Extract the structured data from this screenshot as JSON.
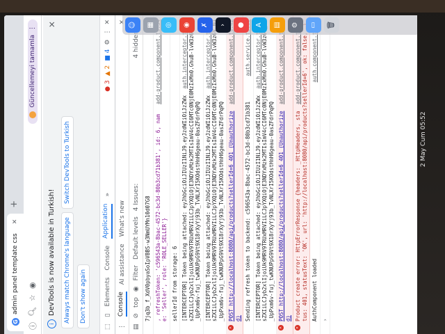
{
  "menubar": {
    "clock": "2 May Cum 05:52"
  },
  "browser": {
    "tab_title": "admin panel template css",
    "new_tab": "+",
    "update_button": "Güncellemeyi tamamla"
  },
  "infobar": {
    "message": "DevTools is now available in Turkish!",
    "btn_always_match": "Always match Chrome's language",
    "btn_switch": "Switch DevTools to Turkish",
    "btn_dont_show": "Don't show again"
  },
  "devtools": {
    "tabs": [
      "Elements",
      "Console",
      "Application"
    ],
    "more": "»",
    "errors": "3",
    "warnings": "2",
    "infos": "4",
    "drawer_tabs": [
      "Console",
      "AI assistance",
      "What's new"
    ],
    "context": "top",
    "filter_placeholder": "Filter",
    "levels": "Default levels",
    "issues": "4 Issues:",
    "issues_count": "4",
    "hidden": "4 hidden"
  },
  "console": {
    "entries": [
      {
        "kind": "log",
        "text": "7jq3b_f_XdV0pbyaSoIpVBBS-w3NmUYMn10d07G8",
        "src": ""
      },
      {
        "kind": "log",
        "text": ", refreshToken: 'c596543a-8bac-4572-bc3d-80b3cd71b381', id: 6, name: 'Seller', role: 'ROLE_SELLER'}",
        "src": "add-product.component.ts:34"
      },
      {
        "kind": "log",
        "text": "sellerId from storage: 6",
        "src": ""
      },
      {
        "kind": "log",
        "text": "[INTERCEPTOR] Token being attached: eyJhbGciOiJIUzI1NiJ9.eyJzdWIiOiJzZWxsZXIiLCJyb2xlIjoiUk9MRV9TRUxMRVIiLCJpYXQiOjE3NDYxMzk2MTIsImV4cCI6MTc0NjE0MzIxMn0.GhuB-lvW3z6V_Nu_UpPxm6v-fuj_twKNUPpG9Vt9X18rXyYj93b_TvNLXrI5KOdstHnH6geau-0asZFdrPqPQ",
        "src": "auth.interceptor.ts:19"
      },
      {
        "kind": "log",
        "text": "[INTERCEPTOR] Token being attached: eyJhbGciOiJIUzI1NiJ9.eyJzdWIiOiJzZWxsZXIiLCJyb2xlIjoiUk9MRV9TRUxMRVIiLCJpYXQiOjE3NDYxMzk2MTIsImV4cCI6MTc0NjE0MzIxMn0.GhuB-lvW3z6V_Nu_UpPxm6v-fuj_twKNUPpG9Vt9X18rXyYj93b_TvNLXrI5KOdstHnH6geau-0asZFdrPqPQ",
        "src": "auth.interceptor.ts:19"
      },
      {
        "kind": "err",
        "text": "POST http://localhost:8080/api/products?sellerId=6 401 (Unauthorized)",
        "src": "add-product.component.ts:42"
      },
      {
        "kind": "log",
        "text": "Sending refresh token to backend: c596543a-8bac-4572-bc3d-80b3cd71b381",
        "src": "auth.service.ts:69"
      },
      {
        "kind": "log",
        "text": "[INTERCEPTOR] Token being attached: eyJhbGciOiJIUzI1NiJ9.eyJzdWIiOiJzZWxsZXIiLCJyb2xlIjoiUk9MRV9TRUxMRVIiLCJpYXQiOjE3NDYxMzk2MTIsImV4cCI6MTc0NjE0MzIxMn0.GhuB-lvW3z6V_Nu_UpPxm6v-fuj_twKNUPpG9Vt9X18rXyYj93b_TvNLXrI5KOdstHnH6geau-0asZFdrPqPQ",
        "src": "auth.interceptor.ts:19"
      },
      {
        "kind": "err",
        "text": "POST http://localhost:8080/api/products?sellerId=6 401 (Unauthorized)",
        "src": "add-product.component.ts:42"
      },
      {
        "kind": "err",
        "text": "Product create error: HttpErrorResponse {headers: _HttpHeaders, status: 401, statusText: 'OK', url: 'http://localhost:8080/api/products?sellerId=6', ok: false, …}",
        "src": "add-product.component.ts:47"
      },
      {
        "kind": "log",
        "text": "AuthComponent loaded",
        "src": "auth.component.ts:12"
      }
    ]
  },
  "colors": {
    "accent": "#1a73e8",
    "error": "#d93025",
    "warning": "#e37400",
    "update_pill": "#e8e1f3"
  },
  "dock": {
    "apps": [
      "finder-icon",
      "launchpad-icon",
      "safari-icon",
      "chrome-icon",
      "xcode-icon",
      "terminal-icon",
      "vpn-icon",
      "app-store-icon",
      "notes-icon",
      "settings-icon",
      "folder-icon",
      "trash-icon"
    ]
  }
}
